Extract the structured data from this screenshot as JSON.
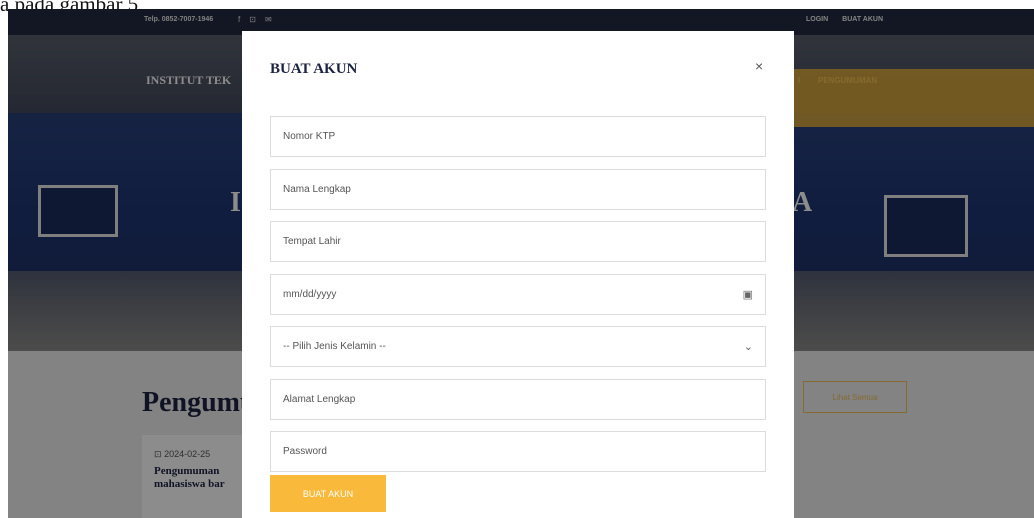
{
  "doc_caption": "a pada gambar 5",
  "site": {
    "topbar": {
      "phone": "Telp. 0852-7007-1946",
      "social": [
        "f",
        "⊡",
        "✉"
      ],
      "login": "LOGIN",
      "register": "BUAT AKUN"
    },
    "hero": {
      "brand": "INSTITUT TEK",
      "nav_right": "I",
      "nav_announcements": "PENGUMUMAN",
      "left_letter": "I",
      "right_letter": "A"
    },
    "announcements": {
      "section_title": "Pengumu",
      "see_all": "Lihat Semua",
      "card": {
        "date": "2024-02-25",
        "title": "Pengumuman mahasiswa bar"
      }
    }
  },
  "modal": {
    "title": "BUAT AKUN",
    "close": "×",
    "fields": {
      "ktp": "Nomor KTP",
      "name": "Nama Lengkap",
      "birthplace": "Tempat Lahir",
      "birthdate": "mm/dd/yyyy",
      "gender": "-- Pilih Jenis Kelamin --",
      "address": "Alamat Lengkap",
      "password": "Password"
    },
    "submit": "BUAT AKUN"
  },
  "icons": {
    "calendar": "calendar-icon",
    "chevron": "chevron-down-icon"
  }
}
